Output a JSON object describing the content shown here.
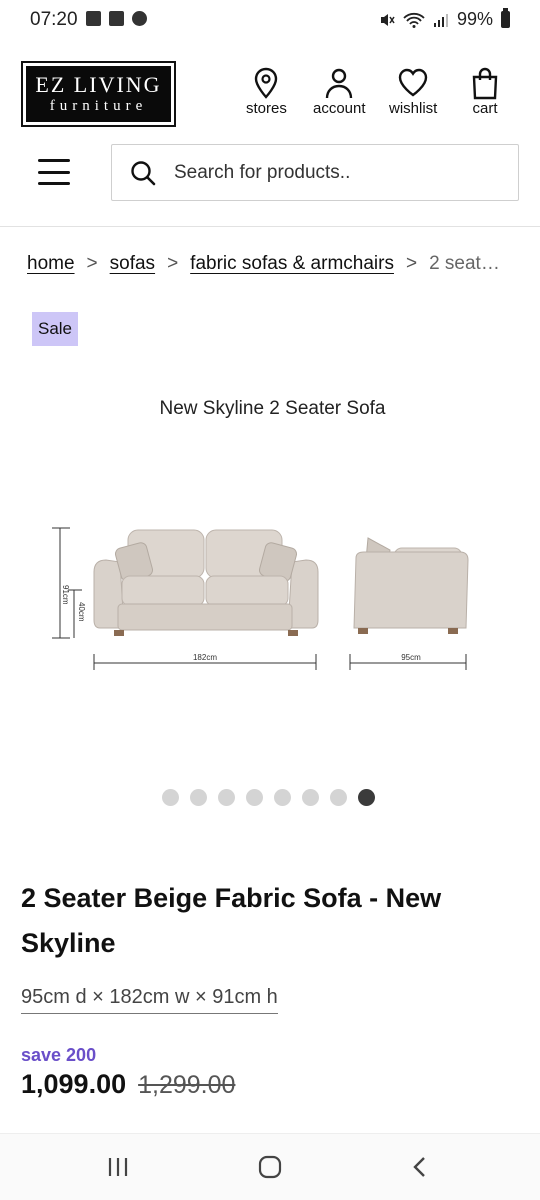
{
  "status_bar": {
    "time": "07:20",
    "battery": "99%",
    "left_icons": [
      "image-icon",
      "record-icon",
      "chat-icon"
    ],
    "right_icons": [
      "mute-icon",
      "wifi-icon",
      "signal-icon",
      "battery-icon"
    ]
  },
  "header": {
    "logo": {
      "line1": "EZ LIVING",
      "line2": "furniture"
    },
    "links": [
      {
        "label": "stores",
        "icon": "location-pin-icon"
      },
      {
        "label": "account",
        "icon": "user-icon"
      },
      {
        "label": "wishlist",
        "icon": "heart-icon"
      },
      {
        "label": "cart",
        "icon": "bag-icon"
      }
    ],
    "search_placeholder": "Search for products.."
  },
  "breadcrumb": {
    "items": [
      "home",
      "sofas",
      "fabric sofas & armchairs"
    ],
    "current": "2 seat…",
    "separator": ">"
  },
  "badge": "Sale",
  "gallery": {
    "image_title": "New Skyline 2 Seater Sofa",
    "dimension_labels": {
      "height_total": "91cm",
      "seat_height": "40cm",
      "width": "182cm",
      "depth": "95cm"
    },
    "dot_count": 8,
    "active_dot": 8
  },
  "product": {
    "name": "2 Seater Beige Fabric Sofa - New Skyline",
    "dimensions": "95cm d × 182cm w × 91cm h",
    "save": "save 200",
    "price": "1,099.00",
    "old_price": "1,299.00"
  },
  "colors": {
    "accent": "#6a4fc9",
    "badge_bg": "#cdc6f7",
    "sofa_fabric": "#d9d2cb"
  },
  "nav_bar": {
    "buttons": [
      "recent-apps-icon",
      "home-icon",
      "back-icon"
    ]
  }
}
